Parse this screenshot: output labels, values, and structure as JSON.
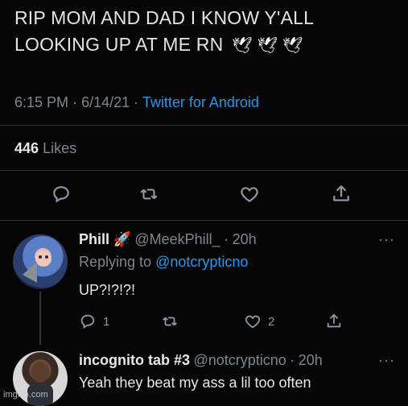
{
  "tweet": {
    "text": "RIP MOM AND DAD I KNOW Y'ALL LOOKING UP AT ME RN",
    "emoji": "🕊 🕊 🕊",
    "time": "6:15 PM",
    "date": "6/14/21",
    "source": "Twitter for Android",
    "likes_count": "446",
    "likes_label": "Likes",
    "sep": "·"
  },
  "icons": {
    "reply": "reply-icon",
    "retweet": "retweet-icon",
    "like": "heart-icon",
    "share": "share-icon",
    "more": "more-icon"
  },
  "replies": [
    {
      "name": "Phill",
      "emoji": "🚀",
      "handle": "@MeekPhill_",
      "time": "20h",
      "replying_prefix": "Replying to",
      "replying_to": "@notcrypticno",
      "text": "UP?!?!?!",
      "reply_count": "1",
      "like_count": "2"
    },
    {
      "name": "incognito tab #3",
      "handle": "@notcrypticno",
      "time": "20h",
      "text": "Yeah they beat my ass a lil too often"
    }
  ],
  "more_label": "···",
  "watermark": "imgflip.com",
  "colors": {
    "background": "#060606",
    "link": "#1d9bf0",
    "muted": "#7d8790",
    "divider": "#2f3336"
  }
}
